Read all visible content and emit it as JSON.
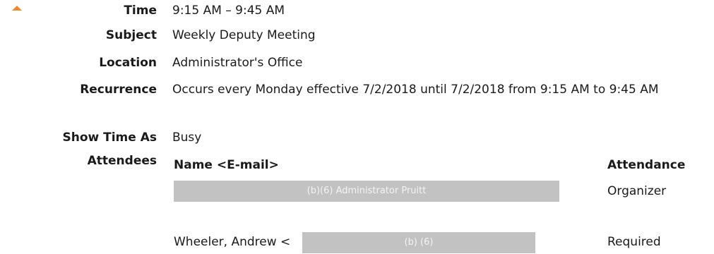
{
  "details": {
    "time_label": "Time",
    "time_value": "9:15 AM – 9:45 AM",
    "subject_label": "Subject",
    "subject_value": "Weekly Deputy Meeting",
    "location_label": "Location",
    "location_value": "Administrator's Office",
    "recurrence_label": "Recurrence",
    "recurrence_value": "Occurs every Monday effective 7/2/2018 until 7/2/2018 from 9:15 AM to 9:45 AM",
    "show_time_as_label": "Show Time As",
    "show_time_as_value": "Busy",
    "attendees_label": "Attendees"
  },
  "attendees": {
    "header_name": "Name <E-mail>",
    "header_attendance": "Attendance",
    "rows": [
      {
        "name": "",
        "redaction_label": "(b)(6) Administrator Pruitt",
        "attendance": "Organizer"
      },
      {
        "name": "Wheeler, Andrew <",
        "redaction_label": "(b) (6)",
        "attendance": "Required"
      }
    ]
  },
  "colors": {
    "collapse_arrow": "#e88a2e",
    "redaction_fill": "#c2c2c2"
  },
  "icons": {
    "collapse": "triangle-up-icon"
  }
}
